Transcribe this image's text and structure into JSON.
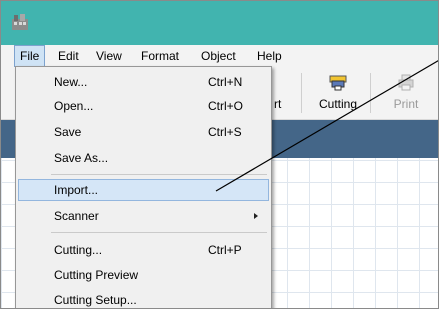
{
  "menubar": {
    "items": [
      {
        "label": "File"
      },
      {
        "label": "Edit"
      },
      {
        "label": "View"
      },
      {
        "label": "Format"
      },
      {
        "label": "Object"
      },
      {
        "label": "Help"
      }
    ]
  },
  "toolbar": {
    "partial_label": "rt",
    "cutting_label": "Cutting",
    "print_label": "Print"
  },
  "file_menu": {
    "items": [
      {
        "label": "New...",
        "shortcut": "Ctrl+N"
      },
      {
        "label": "Open...",
        "shortcut": "Ctrl+O"
      },
      {
        "label": "Save",
        "shortcut": "Ctrl+S"
      },
      {
        "label": "Save As...",
        "shortcut": ""
      },
      {
        "label": "Import...",
        "shortcut": ""
      },
      {
        "label": "Scanner",
        "shortcut": ""
      },
      {
        "label": "Cutting...",
        "shortcut": "Ctrl+P"
      },
      {
        "label": "Cutting Preview",
        "shortcut": ""
      },
      {
        "label": "Cutting Setup...",
        "shortcut": ""
      }
    ],
    "highlighted": "Import..."
  },
  "colors": {
    "titlebar": "#41b4af",
    "bluebar": "#446688",
    "highlight": "#d5e6f7"
  }
}
